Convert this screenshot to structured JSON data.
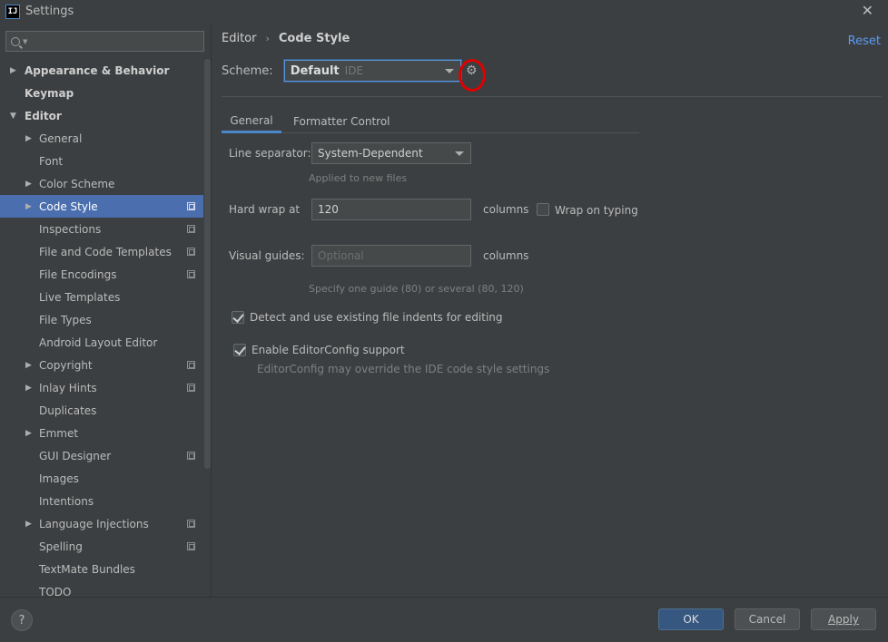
{
  "window": {
    "title": "Settings",
    "app_icon_text": "IJ"
  },
  "search": {
    "placeholder": ""
  },
  "sidebar": {
    "items": [
      {
        "label": "Appearance & Behavior",
        "level": 0,
        "arrow": "collapsed",
        "bold": true,
        "project": false
      },
      {
        "label": "Keymap",
        "level": 0,
        "arrow": "none",
        "bold": true,
        "project": false
      },
      {
        "label": "Editor",
        "level": 0,
        "arrow": "expanded",
        "bold": true,
        "project": false
      },
      {
        "label": "General",
        "level": 1,
        "arrow": "collapsed",
        "bold": false,
        "project": false
      },
      {
        "label": "Font",
        "level": 1,
        "arrow": "none",
        "bold": false,
        "project": false
      },
      {
        "label": "Color Scheme",
        "level": 1,
        "arrow": "collapsed",
        "bold": false,
        "project": false
      },
      {
        "label": "Code Style",
        "level": 1,
        "arrow": "collapsed",
        "bold": false,
        "project": true,
        "selected": true
      },
      {
        "label": "Inspections",
        "level": 1,
        "arrow": "none",
        "bold": false,
        "project": true
      },
      {
        "label": "File and Code Templates",
        "level": 1,
        "arrow": "none",
        "bold": false,
        "project": true
      },
      {
        "label": "File Encodings",
        "level": 1,
        "arrow": "none",
        "bold": false,
        "project": true
      },
      {
        "label": "Live Templates",
        "level": 1,
        "arrow": "none",
        "bold": false,
        "project": false
      },
      {
        "label": "File Types",
        "level": 1,
        "arrow": "none",
        "bold": false,
        "project": false
      },
      {
        "label": "Android Layout Editor",
        "level": 1,
        "arrow": "none",
        "bold": false,
        "project": false
      },
      {
        "label": "Copyright",
        "level": 1,
        "arrow": "collapsed",
        "bold": false,
        "project": true
      },
      {
        "label": "Inlay Hints",
        "level": 1,
        "arrow": "collapsed",
        "bold": false,
        "project": true
      },
      {
        "label": "Duplicates",
        "level": 1,
        "arrow": "none",
        "bold": false,
        "project": false
      },
      {
        "label": "Emmet",
        "level": 1,
        "arrow": "collapsed",
        "bold": false,
        "project": false
      },
      {
        "label": "GUI Designer",
        "level": 1,
        "arrow": "none",
        "bold": false,
        "project": true
      },
      {
        "label": "Images",
        "level": 1,
        "arrow": "none",
        "bold": false,
        "project": false
      },
      {
        "label": "Intentions",
        "level": 1,
        "arrow": "none",
        "bold": false,
        "project": false
      },
      {
        "label": "Language Injections",
        "level": 1,
        "arrow": "collapsed",
        "bold": false,
        "project": true
      },
      {
        "label": "Spelling",
        "level": 1,
        "arrow": "none",
        "bold": false,
        "project": true
      },
      {
        "label": "TextMate Bundles",
        "level": 1,
        "arrow": "none",
        "bold": false,
        "project": false
      },
      {
        "label": "TODO",
        "level": 1,
        "arrow": "none",
        "bold": false,
        "project": false
      }
    ]
  },
  "breadcrumb": {
    "parent": "Editor",
    "separator": "›",
    "current": "Code Style"
  },
  "reset_label": "Reset",
  "scheme": {
    "label": "Scheme:",
    "name": "Default",
    "kind": "IDE"
  },
  "tabs": [
    {
      "label": "General",
      "active": true
    },
    {
      "label": "Formatter Control",
      "active": false
    }
  ],
  "general": {
    "line_separator": {
      "label": "Line separator:",
      "value": "System-Dependent",
      "hint": "Applied to new files"
    },
    "hard_wrap": {
      "label": "Hard wrap at",
      "value": "120",
      "unit": "columns",
      "wrap_on_typing_label": "Wrap on typing",
      "wrap_on_typing_checked": false
    },
    "visual_guides": {
      "label": "Visual guides:",
      "placeholder": "Optional",
      "unit": "columns",
      "hint": "Specify one guide (80) or several (80, 120)"
    },
    "detect_indents": {
      "label": "Detect and use existing file indents for editing",
      "checked": true
    },
    "editorconfig": {
      "label": "Enable EditorConfig support",
      "checked": true,
      "hint": "EditorConfig may override the IDE code style settings"
    }
  },
  "footer": {
    "help": "?",
    "ok": "OK",
    "cancel": "Cancel",
    "apply": "Apply"
  },
  "colors": {
    "accent": "#4a88c7",
    "selection": "#4b6eaf",
    "link": "#589df6",
    "annotation": "#e00000"
  }
}
